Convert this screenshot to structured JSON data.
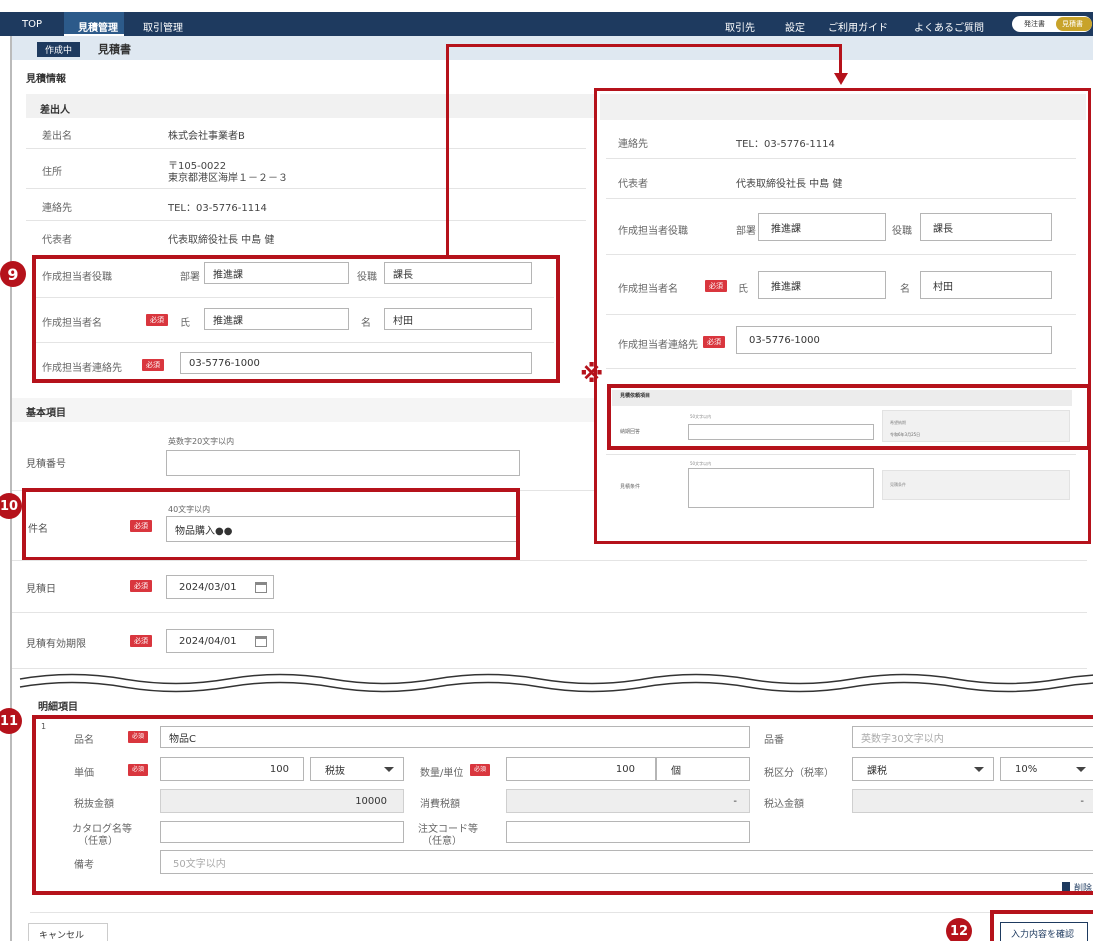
{
  "nav": {
    "top": "TOP",
    "estimate": "見積管理",
    "transaction": "取引管理",
    "partner": "取引先",
    "settings": "設定",
    "guide": "ご利用ガイド",
    "faq": "よくあるご質問",
    "toggle_left": "発注書",
    "toggle_right": "見積書"
  },
  "subheader": {
    "status": "作成中",
    "title": "見積書"
  },
  "sections": {
    "estimate_info": "見積情報",
    "sender": "差出人",
    "basic": "基本項目",
    "details": "明細項目"
  },
  "sender": {
    "name_label": "差出名",
    "name": "株式会社事業者B",
    "address_label": "住所",
    "zip": "〒105-0022",
    "address": "東京都港区海岸１－２－３",
    "contact_label": "連絡先",
    "contact": "TEL：03-5776-1114",
    "rep_label": "代表者",
    "rep": "代表取締役社長 中島 健"
  },
  "creator": {
    "title_label": "作成担当者役職",
    "dept_label": "部署",
    "dept": "推進課",
    "position_label": "役職",
    "position": "課長",
    "name_label": "作成担当者名",
    "required": "必須",
    "family_label": "氏",
    "family": "推進課",
    "given_label": "名",
    "given": "村田",
    "contact_label": "作成担当者連絡先",
    "contact": "03-5776-1000"
  },
  "basic": {
    "number_label": "見積番号",
    "number_hint": "英数字20文字以内",
    "number": "",
    "subject_label": "件名",
    "subject_hint": "40文字以内",
    "subject": "物品購入●●",
    "date_label": "見積日",
    "date": "2024/03/01",
    "expiry_label": "見積有効期限",
    "expiry": "2024/04/01"
  },
  "zoom": {
    "contact_label": "連絡先",
    "contact": "TEL：03-5776-1114",
    "rep_label": "代表者",
    "rep": "代表取締役社長 中島 健",
    "title_label": "作成担当者役職",
    "dept_label": "部署",
    "dept": "推進課",
    "position_label": "役職",
    "position": "課長",
    "name_label": "作成担当者名",
    "family_label": "氏",
    "family": "推進課",
    "given_label": "名",
    "given": "村田",
    "contact2_label": "作成担当者連絡先",
    "contact2": "03-5776-1000",
    "mini_section": "見積依頼項目",
    "mini_row1": "納期回答",
    "mini_hint": "50文字以内",
    "mini_side_label": "希望納期",
    "mini_side_val": "令和6年3月25日",
    "mini_row2": "見積条件",
    "mini_side2": "見積条件"
  },
  "marks": {
    "asterisk": "※",
    "n9": "9",
    "n10": "10",
    "n11": "11",
    "n12": "12"
  },
  "item": {
    "index": "1",
    "name_label": "品名",
    "name": "物品C",
    "code_label": "品番",
    "code_placeholder": "英数字30文字以内",
    "price_label": "単価",
    "price": "100",
    "tax_mode": "税抜",
    "qty_label": "数量/単位",
    "qty": "100",
    "unit": "個",
    "taxcat_label": "税区分（税率）",
    "taxcat": "課税",
    "rate": "10%",
    "pretax_label": "税抜金額",
    "pretax": "10000",
    "tax_label": "消費税額",
    "tax": "-",
    "total_label": "税込金額",
    "total": "-",
    "catalog_label": "カタログ名等",
    "optional": "（任意）",
    "order_label": "注文コード等",
    "note_label": "備考",
    "note_placeholder": "50文字以内",
    "delete": "削除"
  },
  "footer": {
    "cancel": "キャンセル",
    "confirm": "入力内容を確認"
  }
}
